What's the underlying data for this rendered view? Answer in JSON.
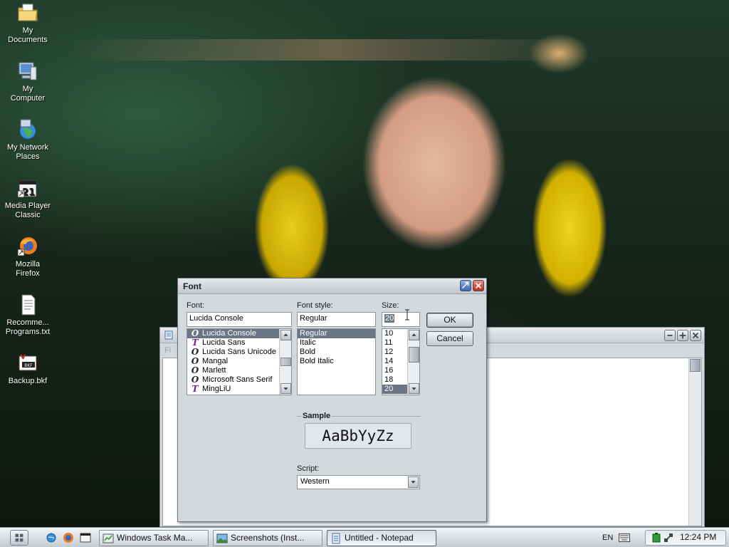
{
  "desktop": {
    "icons": [
      {
        "label": "My\nDocuments",
        "icon": "folder-documents-icon"
      },
      {
        "label": "My\nComputer",
        "icon": "computer-icon"
      },
      {
        "label": "My Network\nPlaces",
        "icon": "network-places-icon"
      },
      {
        "label": "Media Player\nClassic",
        "icon": "media-player-classic-icon"
      },
      {
        "label": "Mozilla\nFirefox",
        "icon": "firefox-icon"
      },
      {
        "label": "Recomme...\nPrograms.txt",
        "icon": "text-file-icon"
      },
      {
        "label": "Backup.bkf",
        "icon": "backup-file-icon"
      }
    ]
  },
  "notepad": {
    "menu_fragment": "Fi"
  },
  "font_dialog": {
    "title": "Font",
    "font_label": "Font:",
    "font_value": "Lucida Console",
    "fonts": [
      {
        "name": "Lucida Console",
        "type": "O",
        "selected": true
      },
      {
        "name": "Lucida Sans",
        "type": "T",
        "selected": false
      },
      {
        "name": "Lucida Sans Unicode",
        "type": "O",
        "selected": false
      },
      {
        "name": "Mangal",
        "type": "O",
        "selected": false
      },
      {
        "name": "Marlett",
        "type": "O",
        "selected": false
      },
      {
        "name": "Microsoft Sans Serif",
        "type": "O",
        "selected": false
      },
      {
        "name": "MingLiU",
        "type": "T",
        "selected": false
      }
    ],
    "style_label": "Font style:",
    "style_value": "Regular",
    "styles": [
      {
        "name": "Regular",
        "selected": true
      },
      {
        "name": "Italic",
        "selected": false
      },
      {
        "name": "Bold",
        "selected": false
      },
      {
        "name": "Bold Italic",
        "selected": false
      }
    ],
    "size_label": "Size:",
    "size_value": "20",
    "sizes": [
      {
        "name": "10",
        "selected": false
      },
      {
        "name": "11",
        "selected": false
      },
      {
        "name": "12",
        "selected": false
      },
      {
        "name": "14",
        "selected": false
      },
      {
        "name": "16",
        "selected": false
      },
      {
        "name": "18",
        "selected": false
      },
      {
        "name": "20",
        "selected": true
      }
    ],
    "ok_label": "OK",
    "cancel_label": "Cancel",
    "sample_legend": "Sample",
    "sample_text": "AaBbYyZz",
    "script_label": "Script:",
    "script_value": "Western"
  },
  "taskbar": {
    "tasks": [
      {
        "label": "Windows Task Ma...",
        "icon": "task-manager-icon",
        "active": false
      },
      {
        "label": "Screenshots (Inst...",
        "icon": "image-viewer-icon",
        "active": false
      },
      {
        "label": "Untitled - Notepad",
        "icon": "notepad-icon",
        "active": true
      }
    ],
    "language": "EN",
    "clock": "12:24 PM"
  }
}
